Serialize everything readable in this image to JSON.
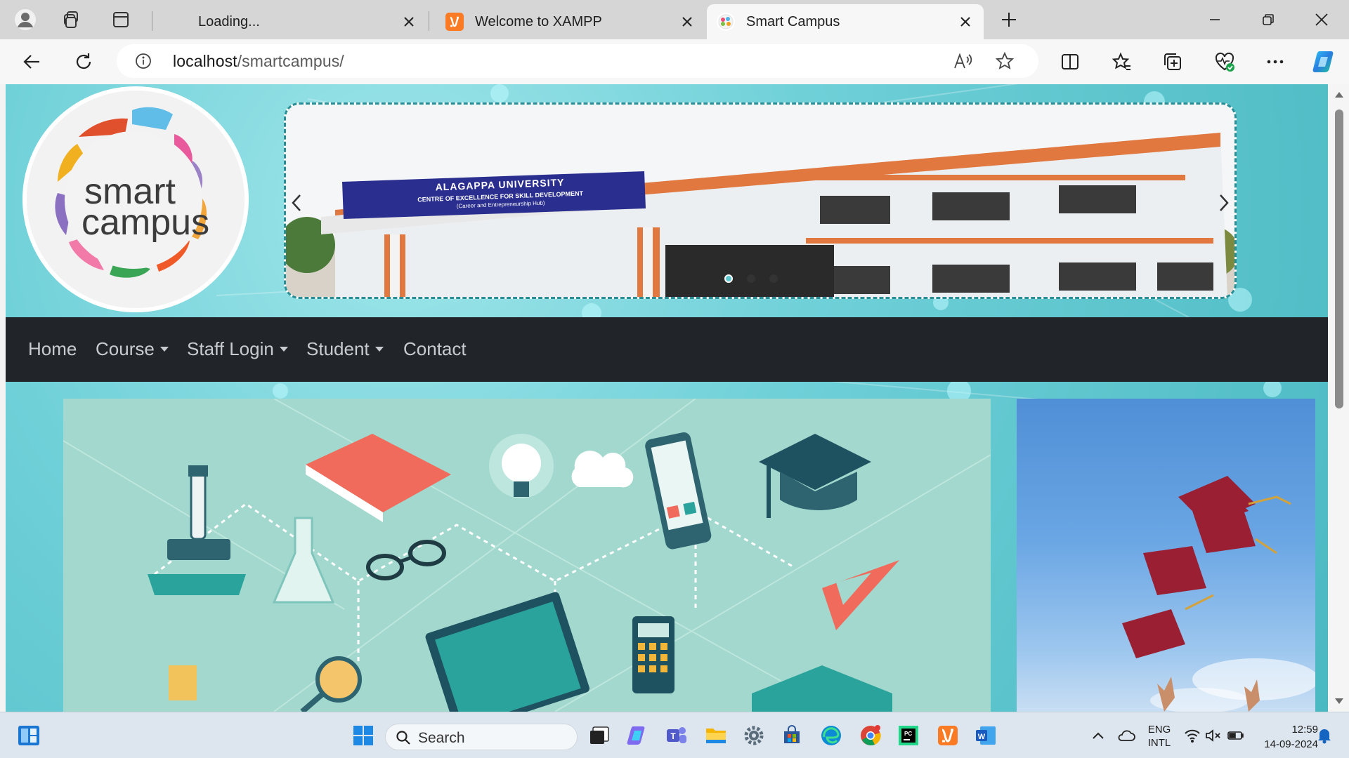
{
  "browser": {
    "tabs": [
      {
        "title": "Loading...",
        "active": false
      },
      {
        "title": "Welcome to XAMPP",
        "active": false
      },
      {
        "title": "Smart Campus",
        "active": true
      }
    ],
    "address": {
      "host": "localhost",
      "path": "/smartcampus/"
    }
  },
  "page": {
    "logo": {
      "line1": "smart",
      "line2": "campus"
    },
    "carousel": {
      "banner": {
        "title": "ALAGAPPA UNIVERSITY",
        "line1": "CENTRE OF EXCELLENCE FOR SKILL DEVELOPMENT",
        "line2": "(Career and Entrepreneurship Hub)"
      },
      "slides_count": 3,
      "active_slide": 1
    },
    "nav": [
      {
        "label": "Home",
        "dropdown": false
      },
      {
        "label": "Course",
        "dropdown": true
      },
      {
        "label": "Staff Login",
        "dropdown": true
      },
      {
        "label": "Student",
        "dropdown": true
      },
      {
        "label": "Contact",
        "dropdown": false
      }
    ]
  },
  "taskbar": {
    "search_label": "Search",
    "lang_line1": "ENG",
    "lang_line2": "INTL",
    "time": "12:59",
    "date": "14-09-2024"
  },
  "colors": {
    "navbar": "#212529",
    "page_bg": "#5cc3cb",
    "accent": "#0078d4"
  }
}
